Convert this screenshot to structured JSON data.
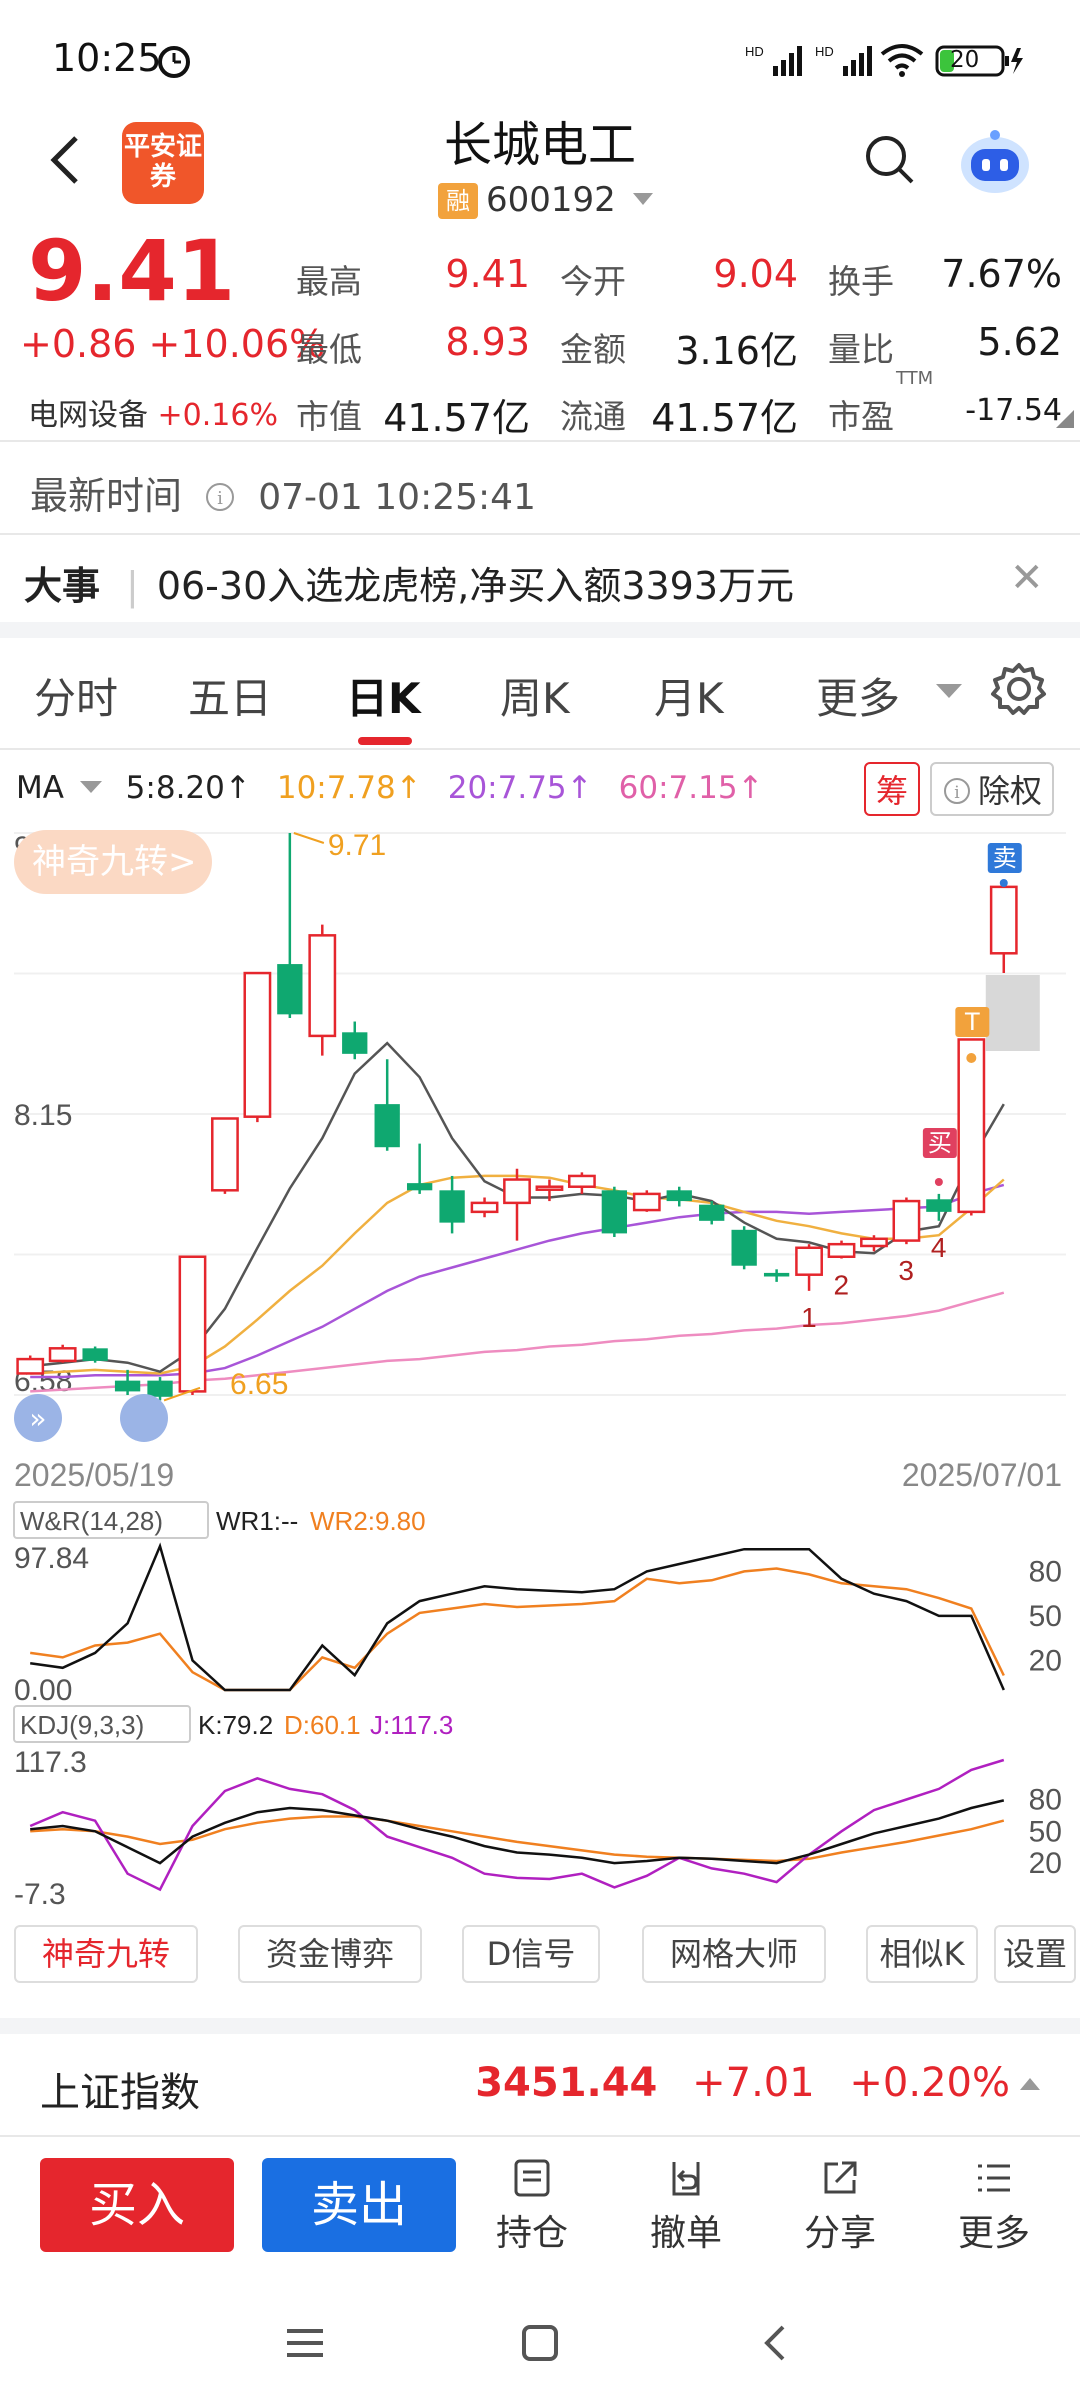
{
  "status_bar": {
    "time": "10:25",
    "battery": "20"
  },
  "header": {
    "logo_text": "平安证券",
    "title": "长城电工",
    "badge": "融",
    "code": "600192"
  },
  "quote": {
    "price": "9.41",
    "change": "+0.86 +10.06%",
    "sector_name": "电网设备",
    "sector_change": "+0.16%",
    "fields": [
      {
        "label": "最高",
        "value": "9.41",
        "color": "#e5262d"
      },
      {
        "label": "今开",
        "value": "9.04",
        "color": "#e5262d"
      },
      {
        "label": "换手",
        "value": "7.67%",
        "color": "#1a1a1a"
      },
      {
        "label": "最低",
        "value": "8.93",
        "color": "#e5262d"
      },
      {
        "label": "金额",
        "value": "3.16亿",
        "color": "#1a1a1a"
      },
      {
        "label": "量比",
        "value": "5.62",
        "color": "#1a1a1a"
      },
      {
        "label": "市值",
        "value": "41.57亿",
        "color": "#1a1a1a"
      },
      {
        "label": "流通",
        "value": "41.57亿",
        "color": "#1a1a1a"
      },
      {
        "label": "市盈",
        "value": "-17.54",
        "color": "#1a1a1a"
      }
    ],
    "pe_sup": "TTM"
  },
  "update": {
    "label": "最新时间",
    "value": "07-01 10:25:41"
  },
  "news": {
    "tag": "大事",
    "text": "06-30入选龙虎榜,净买入额3393万元"
  },
  "tabs": [
    "分时",
    "五日",
    "日K",
    "周K",
    "月K",
    "更多"
  ],
  "ma": {
    "label": "MA",
    "items": [
      {
        "text": "5:8.20↑",
        "color": "#222222"
      },
      {
        "text": "10:7.78↑",
        "color": "#f0a020"
      },
      {
        "text": "20:7.75↑",
        "color": "#a855d8"
      },
      {
        "text": "60:7.15↑",
        "color": "#e060a8"
      }
    ],
    "chip_chou": "筹",
    "chip_rights": "除权"
  },
  "chart": {
    "nine_turn_label": "神奇九转>",
    "price_max_label": "9.71",
    "price_mid_label": "8.15",
    "price_min_label": "6.58",
    "high_marker": "9.71",
    "low_marker": "6.65",
    "date_start": "2025/05/19",
    "date_end": "2025/07/01",
    "buy_tag": "买",
    "sell_tag": "卖",
    "t_tag": "T",
    "wr": {
      "label": "W&R(14,28)",
      "wr1": "WR1:--",
      "wr2": "WR2:9.80",
      "top": "97.84",
      "bottom": "0.00",
      "ticks": [
        "80",
        "50",
        "20"
      ]
    },
    "kdj": {
      "label": "KDJ(9,3,3)",
      "k": "K:79.2",
      "d": "D:60.1",
      "j": "J:117.3",
      "top": "117.3",
      "bottom": "-7.3",
      "ticks": [
        "80",
        "50",
        "20"
      ]
    }
  },
  "chart_data": {
    "type": "candlestick",
    "x_start": "2025/05/19",
    "x_end": "2025/07/01",
    "ylim": [
      6.58,
      9.71
    ],
    "candles": [
      {
        "o": 6.7,
        "c": 6.78,
        "h": 6.8,
        "l": 6.7
      },
      {
        "o": 6.77,
        "c": 6.84,
        "h": 6.86,
        "l": 6.76
      },
      {
        "o": 6.84,
        "c": 6.77,
        "h": 6.85,
        "l": 6.76
      },
      {
        "o": 6.66,
        "c": 6.6,
        "h": 6.72,
        "l": 6.58
      },
      {
        "o": 6.66,
        "c": 6.57,
        "h": 6.68,
        "l": 6.55
      },
      {
        "o": 6.6,
        "c": 7.35,
        "h": 7.35,
        "l": 6.58
      },
      {
        "o": 7.72,
        "c": 8.12,
        "h": 8.12,
        "l": 7.7
      },
      {
        "o": 8.13,
        "c": 8.93,
        "h": 8.93,
        "l": 8.1
      },
      {
        "o": 8.98,
        "c": 8.7,
        "h": 9.71,
        "l": 8.68
      },
      {
        "o": 8.58,
        "c": 9.14,
        "h": 9.2,
        "l": 8.47
      },
      {
        "o": 8.6,
        "c": 8.48,
        "h": 8.66,
        "l": 8.45
      },
      {
        "o": 8.2,
        "c": 7.96,
        "h": 8.45,
        "l": 7.94
      },
      {
        "o": 7.76,
        "c": 7.72,
        "h": 7.98,
        "l": 7.7
      },
      {
        "o": 7.72,
        "c": 7.54,
        "h": 7.8,
        "l": 7.48
      },
      {
        "o": 7.6,
        "c": 7.65,
        "h": 7.68,
        "l": 7.57
      },
      {
        "o": 7.65,
        "c": 7.78,
        "h": 7.84,
        "l": 7.44
      },
      {
        "o": 7.73,
        "c": 7.74,
        "h": 7.78,
        "l": 7.66
      },
      {
        "o": 7.74,
        "c": 7.8,
        "h": 7.82,
        "l": 7.7
      },
      {
        "o": 7.72,
        "c": 7.48,
        "h": 7.74,
        "l": 7.46
      },
      {
        "o": 7.61,
        "c": 7.7,
        "h": 7.72,
        "l": 7.6
      },
      {
        "o": 7.72,
        "c": 7.66,
        "h": 7.74,
        "l": 7.63
      },
      {
        "o": 7.64,
        "c": 7.55,
        "h": 7.66,
        "l": 7.53
      },
      {
        "o": 7.5,
        "c": 7.3,
        "h": 7.52,
        "l": 7.28
      },
      {
        "o": 7.26,
        "c": 7.24,
        "h": 7.28,
        "l": 7.21
      },
      {
        "o": 7.25,
        "c": 7.4,
        "h": 7.42,
        "l": 7.16
      },
      {
        "o": 7.35,
        "c": 7.42,
        "h": 7.44,
        "l": 7.34
      },
      {
        "o": 7.41,
        "c": 7.45,
        "h": 7.47,
        "l": 7.38
      },
      {
        "o": 7.44,
        "c": 7.66,
        "h": 7.68,
        "l": 7.42
      },
      {
        "o": 7.67,
        "c": 7.6,
        "h": 7.7,
        "l": 7.55
      },
      {
        "o": 7.6,
        "c": 8.56,
        "h": 8.56,
        "l": 7.58
      },
      {
        "o": 9.04,
        "c": 9.41,
        "h": 9.41,
        "l": 8.93
      }
    ],
    "ma5": [
      6.74,
      6.76,
      6.78,
      6.76,
      6.71,
      6.83,
      7.06,
      7.4,
      7.73,
      8.01,
      8.37,
      8.54,
      8.35,
      8.01,
      7.77,
      7.68,
      7.68,
      7.7,
      7.69,
      7.66,
      7.7,
      7.66,
      7.54,
      7.45,
      7.43,
      7.38,
      7.37,
      7.49,
      7.52,
      7.89,
      8.2
    ],
    "ma10": [
      6.7,
      6.71,
      6.72,
      6.71,
      6.7,
      6.74,
      6.85,
      7.0,
      7.16,
      7.3,
      7.48,
      7.65,
      7.75,
      7.79,
      7.8,
      7.8,
      7.79,
      7.75,
      7.72,
      7.68,
      7.67,
      7.65,
      7.6,
      7.55,
      7.52,
      7.48,
      7.45,
      7.45,
      7.47,
      7.62,
      7.78
    ],
    "ma20": [
      6.68,
      6.68,
      6.69,
      6.69,
      6.69,
      6.7,
      6.73,
      6.8,
      6.88,
      6.96,
      7.06,
      7.16,
      7.24,
      7.29,
      7.34,
      7.39,
      7.44,
      7.48,
      7.51,
      7.54,
      7.57,
      7.59,
      7.6,
      7.6,
      7.59,
      7.6,
      7.61,
      7.62,
      7.63,
      7.7,
      7.75
    ],
    "ma60": [
      6.6,
      6.61,
      6.62,
      6.63,
      6.64,
      6.66,
      6.67,
      6.69,
      6.71,
      6.73,
      6.75,
      6.77,
      6.78,
      6.8,
      6.82,
      6.83,
      6.85,
      6.86,
      6.88,
      6.89,
      6.91,
      6.92,
      6.94,
      6.95,
      6.97,
      6.98,
      7.0,
      7.02,
      7.05,
      7.1,
      7.15
    ],
    "wr_ylim": [
      0.0,
      97.84
    ],
    "wr1": [
      18,
      15,
      25,
      45,
      97,
      20,
      0,
      0,
      0,
      30,
      10,
      45,
      60,
      65,
      70,
      68,
      67,
      66,
      68,
      80,
      85,
      90,
      95,
      95,
      95,
      75,
      65,
      60,
      50,
      50,
      0
    ],
    "wr2": [
      25,
      22,
      30,
      32,
      38,
      12,
      0,
      0,
      0,
      22,
      15,
      38,
      52,
      55,
      58,
      56,
      57,
      58,
      60,
      75,
      72,
      74,
      80,
      82,
      78,
      72,
      70,
      68,
      62,
      55,
      9.8
    ],
    "kdj_ylim": [
      -7.3,
      117.3
    ],
    "k": [
      52,
      55,
      50,
      35,
      20,
      45,
      58,
      68,
      72,
      70,
      65,
      60,
      52,
      45,
      36,
      30,
      28,
      25,
      20,
      22,
      25,
      24,
      22,
      20,
      28,
      38,
      48,
      55,
      62,
      72,
      79.2
    ],
    "d": [
      50,
      52,
      50,
      45,
      38,
      42,
      52,
      58,
      62,
      64,
      64,
      60,
      55,
      50,
      45,
      40,
      36,
      32,
      28,
      26,
      25,
      24,
      23,
      22,
      24,
      30,
      35,
      40,
      46,
      52,
      60.1
    ],
    "j": [
      55,
      68,
      60,
      10,
      -5,
      55,
      88,
      100,
      90,
      85,
      70,
      45,
      35,
      25,
      10,
      6,
      5,
      10,
      -3,
      8,
      25,
      15,
      10,
      2,
      28,
      50,
      70,
      80,
      90,
      108,
      117.3
    ],
    "wr_ticks": [
      80,
      50,
      20
    ],
    "kdj_ticks": [
      80,
      50,
      20
    ]
  },
  "func_buttons": [
    "神奇九转",
    "资金博弈",
    "D信号",
    "网格大师",
    "相似K",
    "设置"
  ],
  "index": {
    "name": "上证指数",
    "value": "3451.44",
    "change": "+7.01",
    "pct": "+0.20%"
  },
  "bottom": {
    "buy": "买入",
    "sell": "卖出",
    "actions": [
      "持仓",
      "撤单",
      "分享",
      "更多"
    ]
  },
  "colors": {
    "up": "#e5262d",
    "down": "#0fa870",
    "ma5": "#555555",
    "ma10": "#f0b040",
    "ma20": "#a855d8",
    "ma60": "#ee8cc0"
  }
}
